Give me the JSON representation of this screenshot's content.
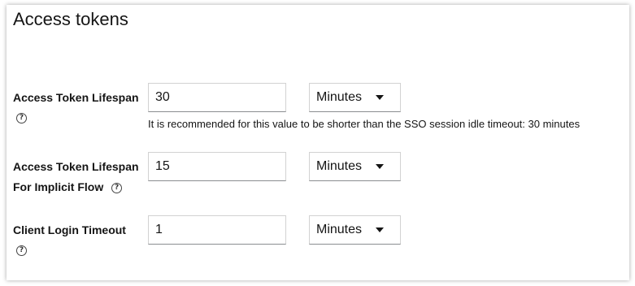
{
  "section": {
    "title": "Access tokens"
  },
  "fields": [
    {
      "label": "Access Token Lifespan",
      "value": "30",
      "unit": "Minutes",
      "hint": "It is recommended for this value to be shorter than the SSO session idle timeout: 30 minutes",
      "help_icon": "question-circle-icon"
    },
    {
      "label_line1": "Access Token Lifespan",
      "label_line2": "For Implicit Flow",
      "value": "15",
      "unit": "Minutes",
      "help_icon": "question-circle-icon"
    },
    {
      "label": "Client Login Timeout",
      "value": "1",
      "unit": "Minutes",
      "help_icon": "question-circle-icon"
    }
  ],
  "help_glyph": "?"
}
